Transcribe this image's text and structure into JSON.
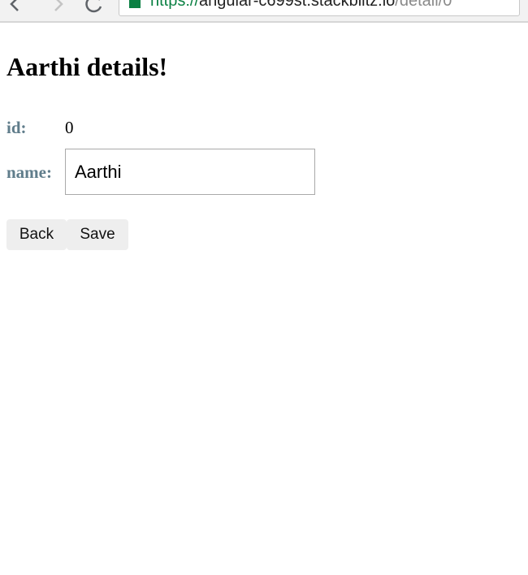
{
  "browser": {
    "url_scheme": "https://",
    "url_host": "angular-c699st.stackblitz.io",
    "url_path": "/detail/0"
  },
  "page": {
    "title": "Aarthi details!",
    "id_label": "id:",
    "id_value": "0",
    "name_label": "name:",
    "name_value": "Aarthi"
  },
  "buttons": {
    "back_label": "Back",
    "save_label": "Save"
  },
  "colors": {
    "label": "#607d8b",
    "button_bg": "#eeeeee",
    "secure_green": "#0b8043"
  }
}
